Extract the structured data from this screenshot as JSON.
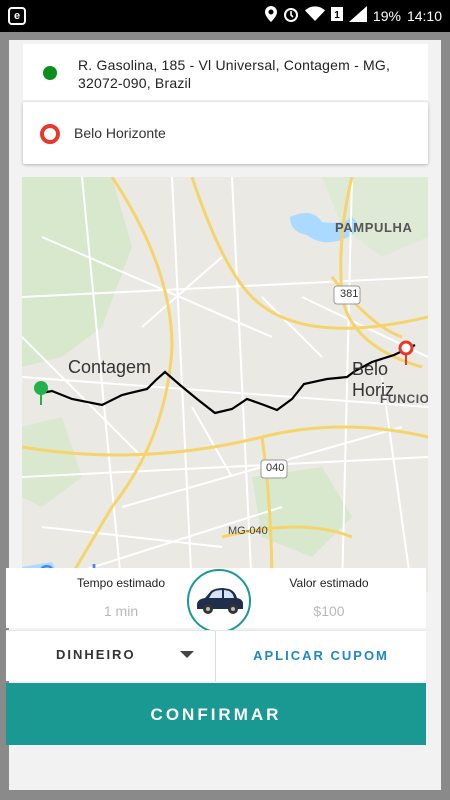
{
  "status_bar": {
    "app_icon_letter": "e",
    "battery": "19%",
    "time": "14:10",
    "icons": [
      "location-icon",
      "alarm-icon",
      "wifi-icon",
      "signal-icon",
      "battery-icon"
    ]
  },
  "origin": {
    "address": "R. Gasolina, 185 - Vl Universal, Contagem - MG, 32072-090, Brazil",
    "marker_color": "#0a8f1c"
  },
  "destination": {
    "name": "Belo Horizonte",
    "marker_color": "#e5392b"
  },
  "map": {
    "labels": {
      "pampulha": "PAMPULHA",
      "contagem": "Contagem",
      "belo_horizonte": "Belo Horiz",
      "funcionarios": "FUNCION",
      "shield_381": "381",
      "shield_040": "040",
      "mg040": "MG-040"
    },
    "logo": "Google"
  },
  "trip": {
    "time_label": "Tempo estimado",
    "time_value": "1 min",
    "price_label": "Valor estimado",
    "price_value": "$100"
  },
  "payment": {
    "selected": "DINHEIRO"
  },
  "coupon_label": "APLICAR CUPOM",
  "confirm_label": "CONFIRMAR",
  "colors": {
    "accent": "#1a9993",
    "link": "#1e88c9"
  }
}
